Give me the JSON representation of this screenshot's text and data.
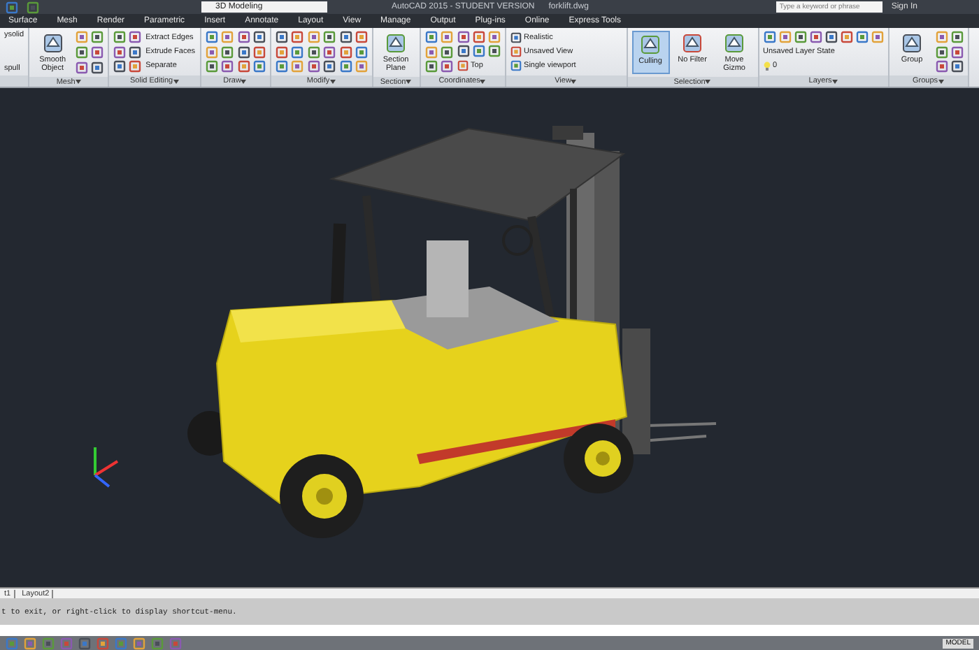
{
  "title_bar": {
    "workspace": "3D Modeling",
    "title": "AutoCAD 2015 - STUDENT VERSION",
    "filename": "forklift.dwg",
    "search": {
      "placeholder": "Type a keyword or phrase"
    },
    "sign_in": "Sign In"
  },
  "ribbon_tabs": [
    {
      "label": "Surface",
      "selected": false
    },
    {
      "label": "Mesh",
      "selected": false
    },
    {
      "label": "Render",
      "selected": false
    },
    {
      "label": "Parametric",
      "selected": false
    },
    {
      "label": "Insert",
      "selected": false
    },
    {
      "label": "Annotate",
      "selected": false
    },
    {
      "label": "Layout",
      "selected": false
    },
    {
      "label": "View",
      "selected": false
    },
    {
      "label": "Manage",
      "selected": false
    },
    {
      "label": "Output",
      "selected": false
    },
    {
      "label": "Plug-ins",
      "selected": false
    },
    {
      "label": "Online",
      "selected": false
    },
    {
      "label": "Express Tools",
      "selected": false
    }
  ],
  "panels": [
    {
      "columns": [
        {
          "kind": "texts",
          "rows": [
            "ysolid",
            "spull"
          ]
        }
      ]
    },
    {
      "label": "Mesh",
      "columns": [
        {
          "kind": "large",
          "label": "Smooth Object"
        },
        {
          "kind": "icons"
        }
      ]
    },
    {
      "label": "Solid Editing",
      "columns": [
        {
          "kind": "icons"
        },
        {
          "kind": "labeled",
          "rows": [
            "Extract Edges",
            "Extrude Faces",
            "Separate"
          ]
        }
      ]
    },
    {
      "label": "Draw",
      "columns": [
        {
          "kind": "icons"
        },
        {
          "kind": "icons"
        }
      ]
    },
    {
      "label": "Modify",
      "columns": [
        {
          "kind": "icons"
        },
        {
          "kind": "icons"
        },
        {
          "kind": "icons"
        }
      ]
    },
    {
      "label": "Section",
      "columns": [
        {
          "kind": "large",
          "label": "Section Plane"
        }
      ]
    },
    {
      "label": "Coordinates",
      "columns": [
        {
          "kind": "icons"
        },
        {
          "kind": "dropdowns",
          "rows": [
            "",
            "",
            "Top"
          ]
        }
      ]
    },
    {
      "label": "View",
      "columns": [
        {
          "kind": "dropdowns",
          "rows": [
            "Realistic",
            "Unsaved View",
            "Single viewport"
          ]
        }
      ]
    },
    {
      "label": "Selection",
      "columns": [
        {
          "kind": "toggle",
          "label": "Culling",
          "selected": true
        },
        {
          "kind": "large",
          "label": "No Filter"
        },
        {
          "kind": "large",
          "label": "Move Gizmo"
        }
      ]
    },
    {
      "label": "Layers",
      "columns": [
        {
          "kind": "layers",
          "rows": [
            "Unsaved Layer State",
            "0"
          ]
        }
      ]
    },
    {
      "label": "Groups",
      "columns": [
        {
          "kind": "large",
          "label": "Group"
        },
        {
          "kind": "icons"
        }
      ]
    }
  ],
  "layout_tabs": [
    "t1",
    "Layout2"
  ],
  "command_history": "t to exit, or right-click to display shortcut-menu.",
  "status_bar": {
    "mode": "MODEL"
  }
}
